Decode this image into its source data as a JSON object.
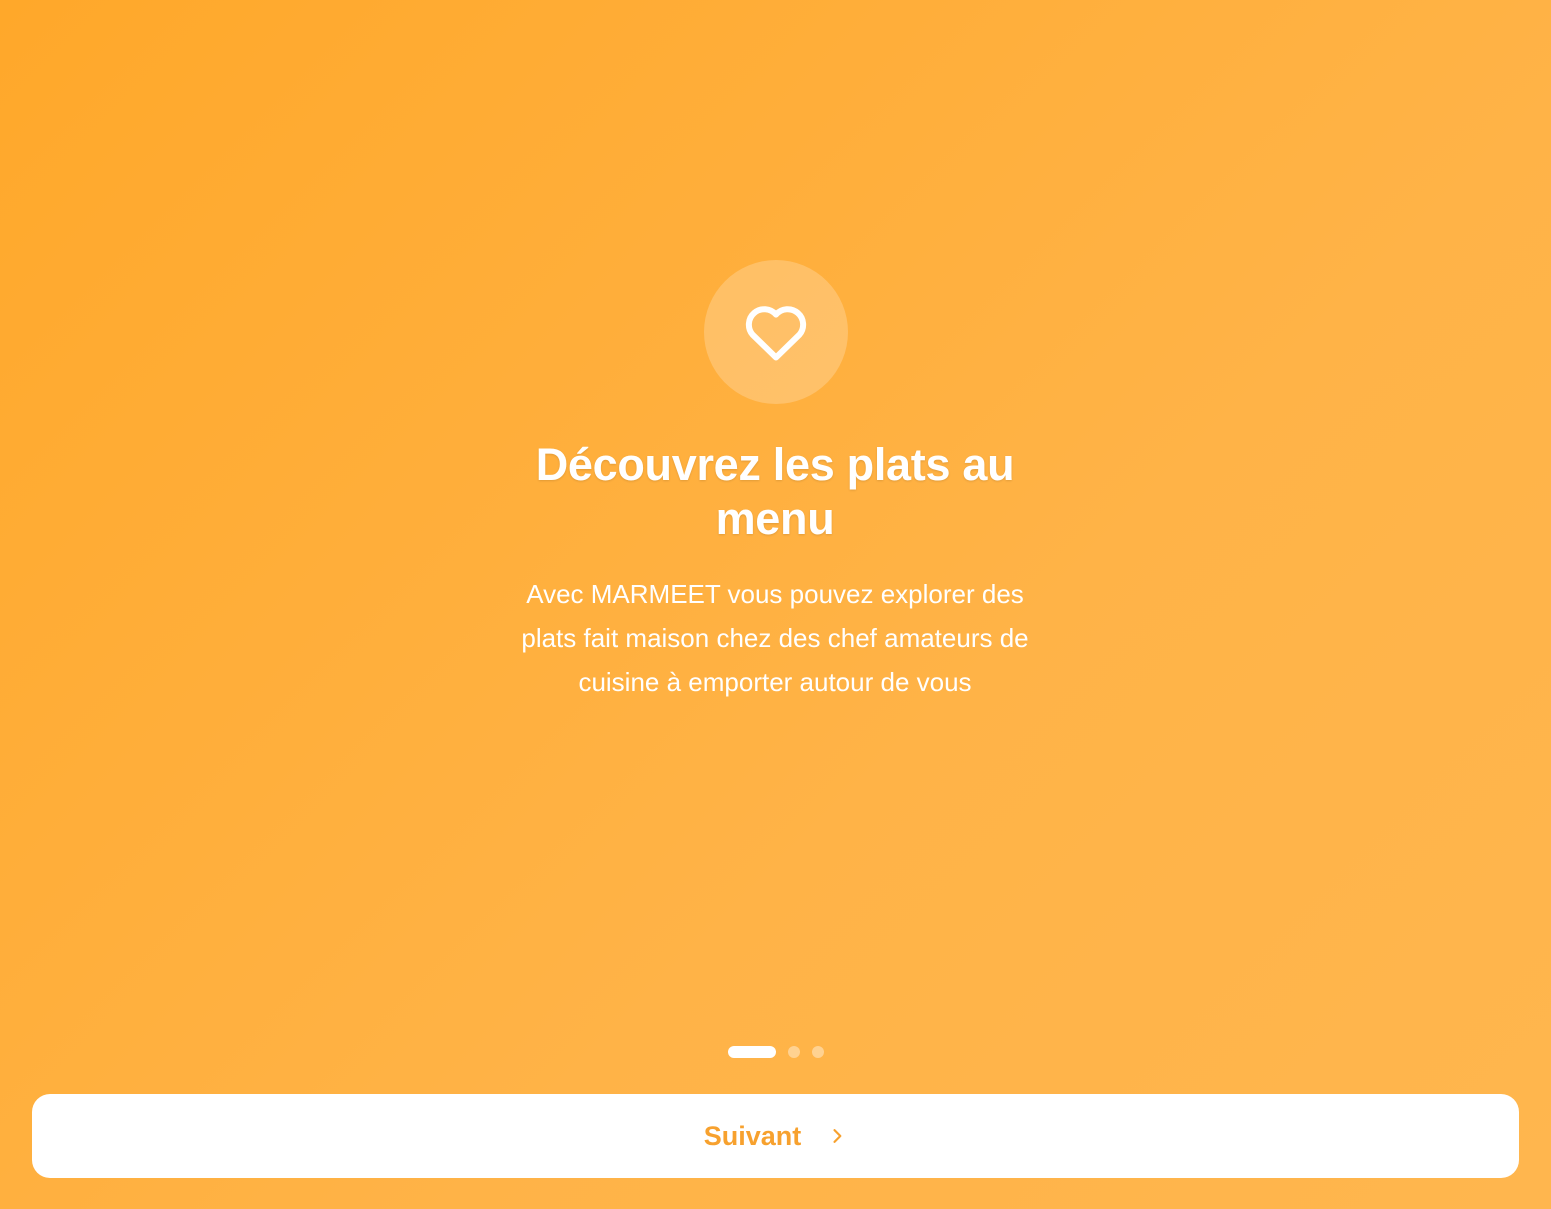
{
  "onboarding": {
    "icon": "heart-icon",
    "title": "Découvrez les plats au menu",
    "description": "Avec MARMEET vous pouvez explorer des plats fait maison chez des chef amateurs de cuisine à emporter autour de vous",
    "pager": {
      "total": 3,
      "active_index": 0
    },
    "next_button": {
      "label": "Suivant",
      "icon": "chevron-right-icon"
    }
  },
  "colors": {
    "background_start": "#FFA82A",
    "background_end": "#FFB64E",
    "button_background": "#FFFFFF",
    "button_text": "#F7A12E",
    "text": "#FFFFFF"
  }
}
